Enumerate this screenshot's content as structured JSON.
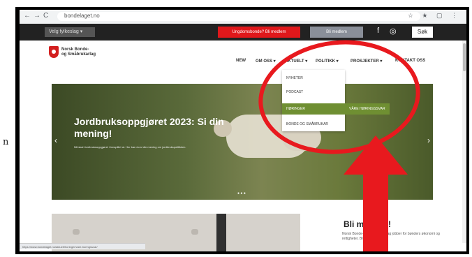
{
  "browser": {
    "url": "bondelaget.no",
    "nav_back": "←",
    "nav_forward": "→",
    "nav_reload": "C"
  },
  "topbar": {
    "language": "Velg fylkeslag ▾",
    "red_button": "Ungdomsbonde? Bli medlem",
    "grey_button": "Bli medlem",
    "facebook_icon": "f",
    "instagram_icon": "◎",
    "search_label": "Søk"
  },
  "header": {
    "brand_line1": "Norsk Bonde-",
    "brand_line2": "og Småbrukarlag",
    "menu": [
      "NEW",
      "OM OSS ▾",
      "AKTUELT ▾",
      "POLITIKK ▾",
      "PROSJEKTER ▾",
      "KONTAKT OSS"
    ]
  },
  "dropdown": {
    "items": [
      "NYHETER",
      "PODCAST",
      "HØRINGER",
      "BONDE OG SMÅBRUKAR"
    ],
    "submenu": "VÅRE HØRINGSSVAR"
  },
  "hero": {
    "title": "Jordbruksoppgjøret 2023: Si din mening!",
    "subtitle": "Nå skal Jordbruksoppgjøret i innspillet ut. Her kan du si din mening om jordbrukspolitikken.",
    "dots": "● ● ●",
    "prev": "‹",
    "next": "›"
  },
  "promo": {
    "title": "Bli medlem!",
    "text": "Norsk Bonde- og Småbrukarlag jobber for bønders økonomi og rettigheter. Bli medlem i dag."
  },
  "statusbar": {
    "text": "https://www.bondelaget.no/aktuelt/horinger/vare-horingssvar/"
  },
  "side_letter": "n",
  "colors": {
    "annotation_red": "#e8191e",
    "menu_green": "#6f8f32",
    "topbar": "#222222"
  }
}
